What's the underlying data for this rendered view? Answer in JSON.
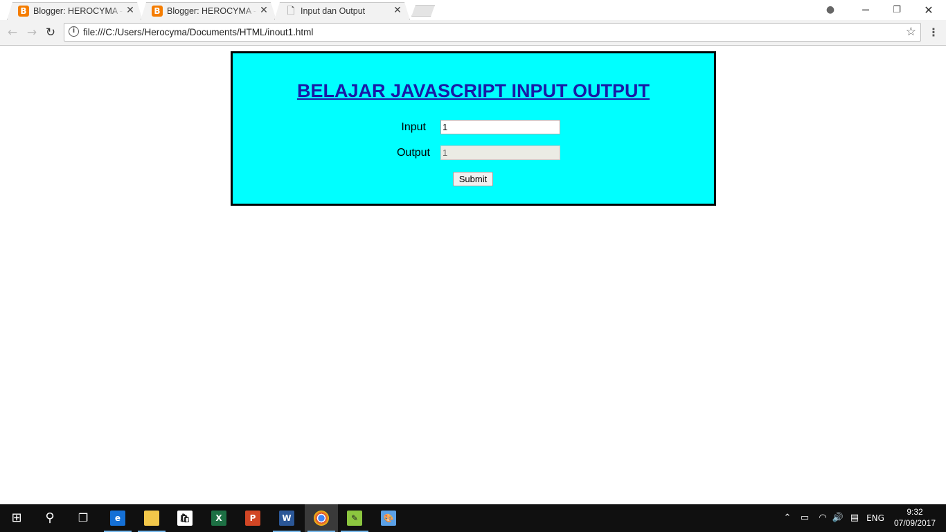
{
  "browser": {
    "tabs": [
      {
        "label": "Blogger: HEROCYMA - Se",
        "icon": "blogger-icon",
        "active": false
      },
      {
        "label": "Blogger: HEROCYMA - Pe",
        "icon": "blogger-icon",
        "active": false
      },
      {
        "label": "Input dan Output",
        "icon": "document-icon",
        "active": true
      }
    ],
    "url": "file:///C:/Users/Herocyma/Documents/HTML/inout1.html"
  },
  "page": {
    "heading": "BELAJAR JAVASCRIPT INPUT OUTPUT",
    "input_label": "Input",
    "input_value": "1",
    "output_label": "Output",
    "output_value": "1",
    "submit_label": "Submit",
    "panel_color": "#00ffff",
    "heading_color": "#1a1aa6"
  },
  "taskbar": {
    "items": [
      "start-icon",
      "search-icon",
      "task-view-icon",
      "edge-icon",
      "file-explorer-icon",
      "store-icon",
      "excel-icon",
      "powerpoint-icon",
      "word-icon",
      "chrome-icon",
      "notepad-plus-icon",
      "paint-icon"
    ],
    "language": "ENG",
    "time": "9:32",
    "date": "07/09/2017"
  }
}
